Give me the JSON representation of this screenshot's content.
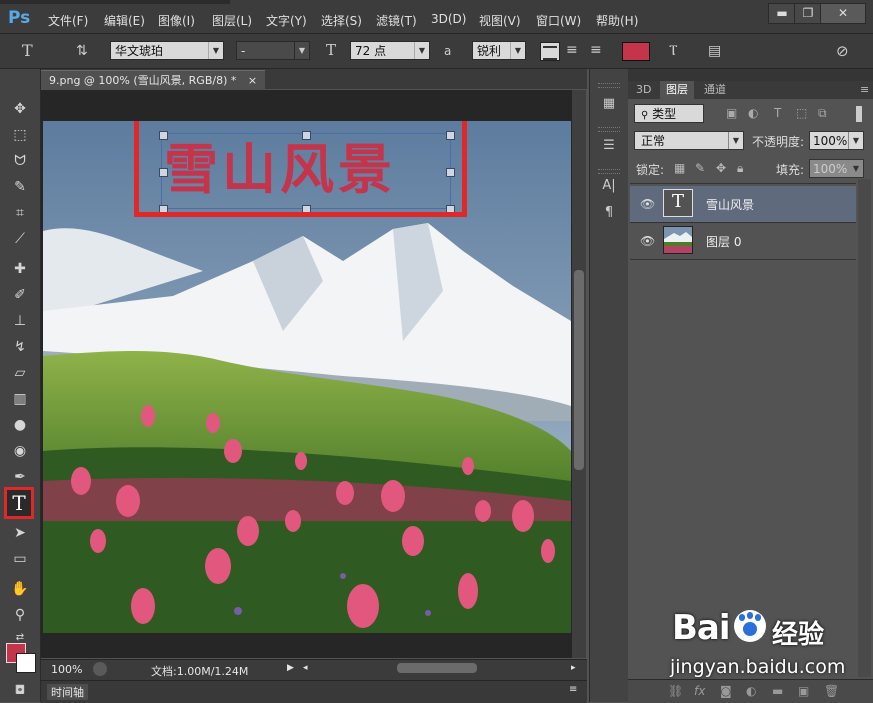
{
  "app": {
    "logo": "Ps"
  },
  "menu": [
    "文件(F)",
    "编辑(E)",
    "图像(I)",
    "图层(L)",
    "文字(Y)",
    "选择(S)",
    "滤镜(T)",
    "3D(D)",
    "视图(V)",
    "窗口(W)",
    "帮助(H)"
  ],
  "window_controls": {
    "minimize": "▬",
    "restore": "❐",
    "close": "✕"
  },
  "options": {
    "tool_glyph": "T",
    "font_family": "华文琥珀",
    "font_style": "-",
    "size_glyph": "T",
    "font_size": "72 点",
    "aa_glyph": "a",
    "antialias": "锐利",
    "text_color": "#c4344b"
  },
  "document": {
    "tab_title": "9.png @ 100% (雪山风景, RGB/8) *",
    "tab_close": "×",
    "canvas_text": "雪山风景",
    "text_color": "#c4344b",
    "zoom": "100%",
    "doc_info": "文档:1.00M/1.24M"
  },
  "timeline": {
    "label": "时间轴"
  },
  "panels": {
    "tabs": [
      "3D",
      "图层",
      "通道"
    ],
    "active_tab": "图层",
    "filter_label": "类型",
    "blend_mode": "正常",
    "opacity_label": "不透明度:",
    "opacity_value": "100%",
    "lock_label": "锁定:",
    "fill_label": "填充:",
    "fill_value": "100%",
    "layers": [
      {
        "name": "雪山风景",
        "kind": "text",
        "selected": true
      },
      {
        "name": "图层 0",
        "kind": "image",
        "selected": false
      }
    ]
  },
  "watermark": {
    "brand": "Bai",
    "brand_suffix": "经验",
    "url": "jingyan.baidu.com"
  },
  "colors": {
    "accent_red": "#e02828",
    "selection_blue": "#5f6b7c",
    "ps_blue": "#58a9e8"
  }
}
